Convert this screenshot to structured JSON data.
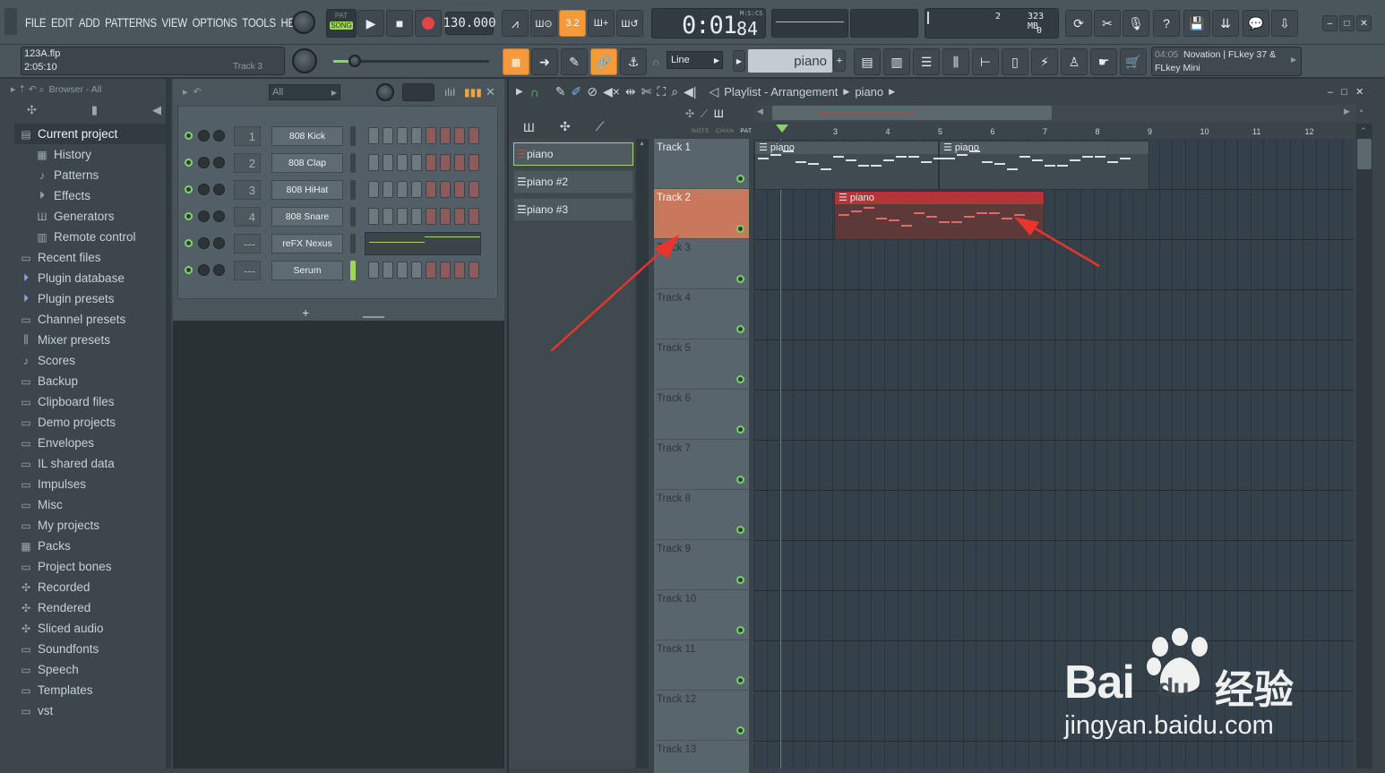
{
  "menu": [
    "FILE",
    "EDIT",
    "ADD",
    "PATTERNS",
    "VIEW",
    "OPTIONS",
    "TOOLS",
    "HELP"
  ],
  "transport": {
    "pat_label": "PAT",
    "song_label": "SONG",
    "tempo": "130.000",
    "time_main": "0:01",
    "time_sub": "84",
    "time_format": "M:S:CS"
  },
  "monitor": {
    "cpu": "2",
    "memory": "323 MB",
    "voices": "0"
  },
  "project": {
    "filename": "123A.flp",
    "time": "2:05:10",
    "hint": "Track 3"
  },
  "toolbar2": {
    "snap": "Line",
    "pattern": "piano",
    "plus": "+",
    "midi_time": "04:05",
    "midi_device": "Novation | FLkey 37 &",
    "midi_device2": "FLkey Mini"
  },
  "browser": {
    "header": "Browser - All",
    "items": [
      {
        "label": "Current project",
        "icon": "doc"
      },
      {
        "label": "History",
        "icon": "history"
      },
      {
        "label": "Patterns",
        "icon": "note"
      },
      {
        "label": "Effects",
        "icon": "plug"
      },
      {
        "label": "Generators",
        "icon": "keys"
      },
      {
        "label": "Remote control",
        "icon": "remote"
      },
      {
        "label": "Recent files",
        "icon": "folder"
      },
      {
        "label": "Plugin database",
        "icon": "plug"
      },
      {
        "label": "Plugin presets",
        "icon": "plug"
      },
      {
        "label": "Channel presets",
        "icon": "folder"
      },
      {
        "label": "Mixer presets",
        "icon": "mixer"
      },
      {
        "label": "Scores",
        "icon": "note"
      },
      {
        "label": "Backup",
        "icon": "folder"
      },
      {
        "label": "Clipboard files",
        "icon": "folder"
      },
      {
        "label": "Demo projects",
        "icon": "folder"
      },
      {
        "label": "Envelopes",
        "icon": "folder"
      },
      {
        "label": "IL shared data",
        "icon": "folder"
      },
      {
        "label": "Impulses",
        "icon": "folder"
      },
      {
        "label": "Misc",
        "icon": "folder"
      },
      {
        "label": "My projects",
        "icon": "folder"
      },
      {
        "label": "Packs",
        "icon": "packs"
      },
      {
        "label": "Project bones",
        "icon": "folder"
      },
      {
        "label": "Recorded",
        "icon": "wave"
      },
      {
        "label": "Rendered",
        "icon": "wave"
      },
      {
        "label": "Sliced audio",
        "icon": "wave"
      },
      {
        "label": "Soundfonts",
        "icon": "folder"
      },
      {
        "label": "Speech",
        "icon": "folder"
      },
      {
        "label": "Templates",
        "icon": "folder"
      },
      {
        "label": "vst",
        "icon": "folder"
      }
    ]
  },
  "rack": {
    "filter": "All",
    "add": "+",
    "channels": [
      {
        "num": "1",
        "name": "808 Kick"
      },
      {
        "num": "2",
        "name": "808 Clap"
      },
      {
        "num": "3",
        "name": "808 HiHat"
      },
      {
        "num": "4",
        "name": "808 Snare"
      },
      {
        "num": "---",
        "name": "reFX Nexus"
      },
      {
        "num": "---",
        "name": "Serum"
      }
    ]
  },
  "playlist": {
    "title": "Playlist - Arrangement",
    "pattern": "piano",
    "col_note": "NOTE",
    "col_chan": "CHAN",
    "col_pat": "PAT",
    "patterns": [
      "piano",
      "piano #2",
      "piano #3"
    ],
    "tracks": [
      "Track 1",
      "Track 2",
      "Track 3",
      "Track 4",
      "Track 5",
      "Track 6",
      "Track 7",
      "Track 8",
      "Track 9",
      "Track 10",
      "Track 11",
      "Track 12",
      "Track 13"
    ],
    "ruler": [
      "3",
      "4",
      "5",
      "6",
      "7",
      "8",
      "9",
      "10",
      "11",
      "12"
    ],
    "clips": [
      {
        "label": "piano"
      },
      {
        "label": "piano"
      },
      {
        "label": "piano"
      }
    ]
  },
  "watermark": {
    "brand": "Bai",
    "brand2": "du",
    "cn": "经验",
    "url": "jingyan.baidu.com"
  },
  "colors": {
    "accent": "#f49a3c",
    "selected_track": "#c9785c",
    "clip_red": "#b33636",
    "led_green": "#77d16a"
  }
}
